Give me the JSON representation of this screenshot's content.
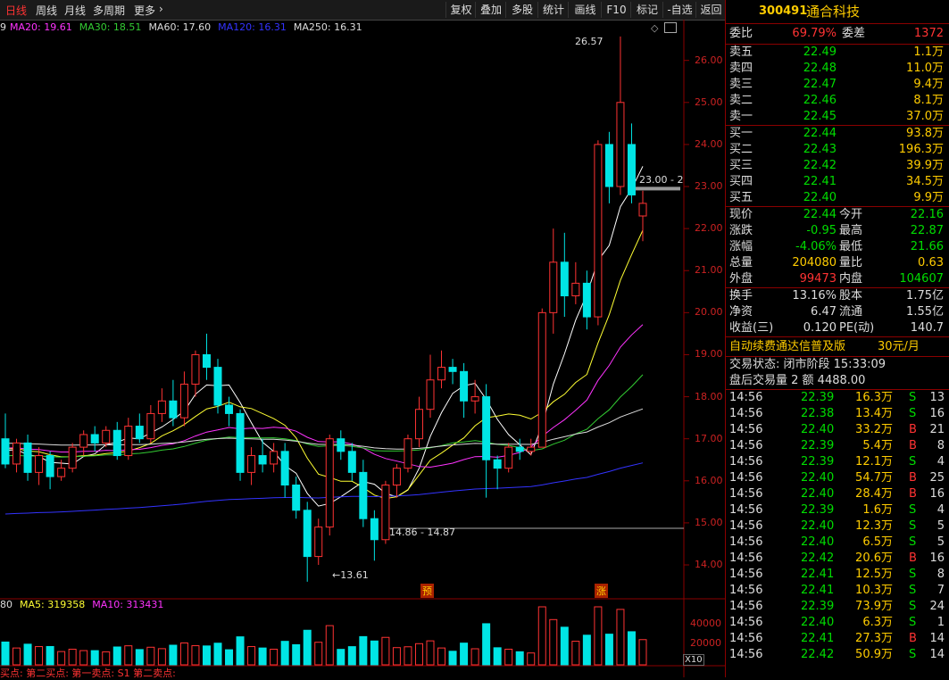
{
  "toolbar": {
    "tabs": [
      {
        "label": "日线",
        "active": true
      },
      {
        "label": "周线",
        "active": false
      },
      {
        "label": "月线",
        "active": false
      },
      {
        "label": "多周期",
        "active": false
      },
      {
        "label": "更多",
        "active": false
      }
    ],
    "buttons": [
      "复权",
      "叠加",
      "多股",
      "统计",
      "画线",
      "F10",
      "标记",
      "-自选",
      "返回"
    ]
  },
  "ma_legend": [
    {
      "text": "MA20: 19.61",
      "color": "#ff33ff"
    },
    {
      "text": "MA30: 18.51",
      "color": "#33cc33"
    },
    {
      "text": "MA60: 17.60",
      "color": "#dddddd"
    },
    {
      "text": "MA120: 16.31",
      "color": "#3333ff"
    },
    {
      "text": "MA250: 16.31",
      "color": "#dddddd"
    }
  ],
  "price_ticks": [
    "26.00",
    "25.00",
    "24.00",
    "23.00",
    "22.00",
    "21.00",
    "20.00",
    "19.00",
    "18.00",
    "17.00",
    "16.00",
    "15.00",
    "14.00"
  ],
  "annotations": {
    "high": "26.57",
    "low": "13.61",
    "gap": "14.86 - 14.87",
    "right_label": "23.00 - 2",
    "mark_yu": "预",
    "mark_zhang": "涨"
  },
  "volume_legend": [
    {
      "text": "80",
      "color": "#dddddd"
    },
    {
      "text": "MA5: 319358",
      "color": "#ffff33"
    },
    {
      "text": "MA10: 313431",
      "color": "#ff33ff"
    }
  ],
  "volume_ticks": [
    "40000",
    "20000"
  ],
  "volume_unit": "X10",
  "signal_legend": "买点: 第二买点: 第一卖点: S1 第二卖点:",
  "chart_data": {
    "type": "candlestick",
    "ylim": [
      13.3,
      26.8
    ],
    "candles": [
      [
        17.0,
        16.4,
        17.6,
        16.3
      ],
      [
        16.4,
        16.9,
        17.0,
        16.2
      ],
      [
        16.9,
        16.2,
        17.1,
        16.0
      ],
      [
        16.2,
        16.6,
        16.8,
        15.9
      ],
      [
        16.6,
        16.1,
        16.7,
        15.8
      ],
      [
        16.1,
        16.3,
        16.5,
        16.0
      ],
      [
        16.3,
        16.8,
        16.9,
        16.2
      ],
      [
        16.8,
        17.1,
        17.2,
        16.6
      ],
      [
        17.1,
        16.9,
        17.3,
        16.7
      ],
      [
        16.9,
        17.2,
        17.3,
        16.8
      ],
      [
        17.2,
        16.6,
        17.4,
        16.5
      ],
      [
        16.6,
        17.3,
        17.5,
        16.5
      ],
      [
        17.3,
        17.0,
        17.6,
        16.9
      ],
      [
        17.0,
        17.6,
        17.8,
        16.9
      ],
      [
        17.6,
        17.9,
        18.2,
        17.4
      ],
      [
        17.9,
        17.5,
        18.4,
        17.3
      ],
      [
        17.5,
        18.3,
        18.6,
        17.3
      ],
      [
        18.3,
        19.0,
        19.1,
        18.0
      ],
      [
        19.0,
        18.7,
        19.5,
        18.4
      ],
      [
        18.7,
        17.8,
        18.9,
        17.6
      ],
      [
        17.8,
        17.6,
        18.0,
        17.3
      ],
      [
        17.6,
        16.2,
        17.7,
        16.0
      ],
      [
        16.2,
        16.6,
        16.8,
        15.9
      ],
      [
        16.6,
        16.4,
        17.0,
        16.2
      ],
      [
        16.4,
        16.7,
        16.9,
        16.2
      ],
      [
        16.7,
        15.9,
        16.9,
        15.6
      ],
      [
        15.9,
        15.3,
        16.1,
        15.1
      ],
      [
        15.3,
        14.2,
        15.5,
        13.6
      ],
      [
        14.2,
        14.9,
        15.1,
        14.0
      ],
      [
        14.9,
        17.0,
        17.1,
        14.7
      ],
      [
        17.0,
        16.7,
        17.2,
        16.5
      ],
      [
        16.7,
        16.2,
        16.9,
        16.0
      ],
      [
        16.2,
        15.1,
        16.5,
        14.9
      ],
      [
        15.1,
        14.6,
        15.3,
        14.1
      ],
      [
        14.6,
        15.9,
        16.0,
        14.5
      ],
      [
        15.9,
        16.3,
        16.4,
        15.6
      ],
      [
        16.3,
        17.0,
        17.1,
        16.2
      ],
      [
        17.0,
        17.7,
        18.0,
        16.8
      ],
      [
        17.7,
        18.4,
        19.0,
        17.5
      ],
      [
        18.4,
        18.7,
        19.1,
        18.2
      ],
      [
        18.7,
        18.6,
        18.9,
        18.3
      ],
      [
        18.6,
        17.9,
        18.8,
        17.5
      ],
      [
        17.9,
        18.0,
        18.4,
        17.6
      ],
      [
        18.0,
        16.5,
        18.3,
        15.6
      ],
      [
        16.5,
        16.3,
        16.6,
        15.8
      ],
      [
        16.3,
        16.8,
        16.9,
        16.2
      ],
      [
        16.8,
        16.7,
        17.0,
        16.5
      ],
      [
        16.7,
        16.8,
        17.0,
        16.6
      ],
      [
        16.8,
        20.0,
        20.1,
        16.8
      ],
      [
        20.0,
        21.2,
        22.0,
        19.5
      ],
      [
        21.2,
        20.4,
        21.9,
        19.9
      ],
      [
        20.4,
        20.7,
        21.2,
        20.2
      ],
      [
        20.7,
        19.9,
        21.0,
        19.6
      ],
      [
        19.9,
        24.0,
        24.1,
        19.7
      ],
      [
        24.0,
        23.0,
        24.3,
        22.6
      ],
      [
        23.0,
        25.0,
        26.57,
        22.8
      ],
      [
        24.0,
        22.8,
        24.5,
        22.6
      ],
      [
        22.3,
        22.6,
        22.9,
        21.7
      ]
    ]
  },
  "quote": {
    "code": "300491",
    "name": "通合科技",
    "weibi": {
      "label": "委比",
      "value": "69.79%"
    },
    "weicha": {
      "label": "委差",
      "value": "1372"
    },
    "asks": [
      {
        "label": "卖五",
        "price": "22.49",
        "vol": "1.1万"
      },
      {
        "label": "卖四",
        "price": "22.48",
        "vol": "11.0万"
      },
      {
        "label": "卖三",
        "price": "22.47",
        "vol": "9.4万"
      },
      {
        "label": "卖二",
        "price": "22.46",
        "vol": "8.1万"
      },
      {
        "label": "卖一",
        "price": "22.45",
        "vol": "37.0万"
      }
    ],
    "bids": [
      {
        "label": "买一",
        "price": "22.44",
        "vol": "93.8万"
      },
      {
        "label": "买二",
        "price": "22.43",
        "vol": "196.3万"
      },
      {
        "label": "买三",
        "price": "22.42",
        "vol": "39.9万"
      },
      {
        "label": "买四",
        "price": "22.41",
        "vol": "34.5万"
      },
      {
        "label": "买五",
        "price": "22.40",
        "vol": "9.9万"
      }
    ],
    "stats": [
      {
        "l1": "现价",
        "v1": "22.44",
        "c1": "grn",
        "l2": "今开",
        "v2": "22.16",
        "c2": "grn"
      },
      {
        "l1": "涨跌",
        "v1": "-0.95",
        "c1": "grn",
        "l2": "最高",
        "v2": "22.87",
        "c2": "grn"
      },
      {
        "l1": "涨幅",
        "v1": "-4.06%",
        "c1": "grn",
        "l2": "最低",
        "v2": "21.66",
        "c2": "grn"
      },
      {
        "l1": "总量",
        "v1": "204080",
        "c1": "yel",
        "l2": "量比",
        "v2": "0.63",
        "c2": "yel"
      },
      {
        "l1": "外盘",
        "v1": "99473",
        "c1": "red",
        "l2": "内盘",
        "v2": "104607",
        "c2": "grn"
      }
    ],
    "stats2": [
      {
        "l1": "换手",
        "v1": "13.16%",
        "l2": "股本",
        "v2": "1.75亿"
      },
      {
        "l1": "净资",
        "v1": "6.47",
        "l2": "流通",
        "v2": "1.55亿"
      },
      {
        "l1": "收益(三)",
        "v1": "0.120",
        "l2": "PE(动)",
        "v2": "140.7"
      }
    ],
    "ad": "自动续费通达信普及版",
    "ad_price": "30元/月",
    "trade_state": "交易状态: 闭市阶段 15:33:09",
    "after_hours": "盘后交易量 2 额 4488.00"
  },
  "ticks": [
    [
      "14:56",
      "22.39",
      "16.3万",
      "S",
      "13"
    ],
    [
      "14:56",
      "22.38",
      "13.4万",
      "S",
      "16"
    ],
    [
      "14:56",
      "22.40",
      "33.2万",
      "B",
      "21"
    ],
    [
      "14:56",
      "22.39",
      "5.4万",
      "B",
      "8"
    ],
    [
      "14:56",
      "22.39",
      "12.1万",
      "S",
      "4"
    ],
    [
      "14:56",
      "22.40",
      "54.7万",
      "B",
      "25"
    ],
    [
      "14:56",
      "22.40",
      "28.4万",
      "B",
      "16"
    ],
    [
      "14:56",
      "22.39",
      "1.6万",
      "S",
      "4"
    ],
    [
      "14:56",
      "22.40",
      "12.3万",
      "S",
      "5"
    ],
    [
      "14:56",
      "22.40",
      "6.5万",
      "S",
      "5"
    ],
    [
      "14:56",
      "22.42",
      "20.6万",
      "B",
      "16"
    ],
    [
      "14:56",
      "22.41",
      "12.5万",
      "S",
      "8"
    ],
    [
      "14:56",
      "22.41",
      "10.3万",
      "S",
      "7"
    ],
    [
      "14:56",
      "22.39",
      "73.9万",
      "S",
      "24"
    ],
    [
      "14:56",
      "22.40",
      "6.3万",
      "S",
      "1"
    ],
    [
      "14:56",
      "22.41",
      "27.3万",
      "B",
      "14"
    ],
    [
      "14:56",
      "22.42",
      "50.9万",
      "S",
      "14"
    ]
  ]
}
